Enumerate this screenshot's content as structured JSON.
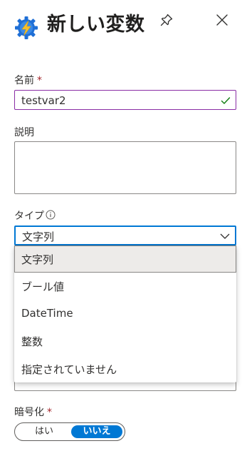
{
  "header": {
    "title": "新しい変数",
    "icon": "automation-bolt-gear-icon",
    "pin_icon": "pin-icon",
    "close_icon": "close-icon"
  },
  "form": {
    "name": {
      "label": "名前",
      "required_mark": "*",
      "value": "testvar2",
      "valid": true
    },
    "description": {
      "label": "説明",
      "value": ""
    },
    "type": {
      "label": "タイプ",
      "selected": "文字列",
      "options": [
        "文字列",
        "ブール値",
        "DateTime",
        "整数",
        "指定されていません"
      ],
      "expanded": true
    },
    "encrypted": {
      "label": "暗号化",
      "required_mark": "*",
      "options": [
        "はい",
        "いいえ"
      ],
      "selected": "いいえ"
    }
  },
  "colors": {
    "accent": "#0078d4",
    "valid_border": "#8a2da5",
    "valid_check": "#107c10",
    "required": "#a4262c",
    "selected_option_bg": "#edebe9"
  }
}
